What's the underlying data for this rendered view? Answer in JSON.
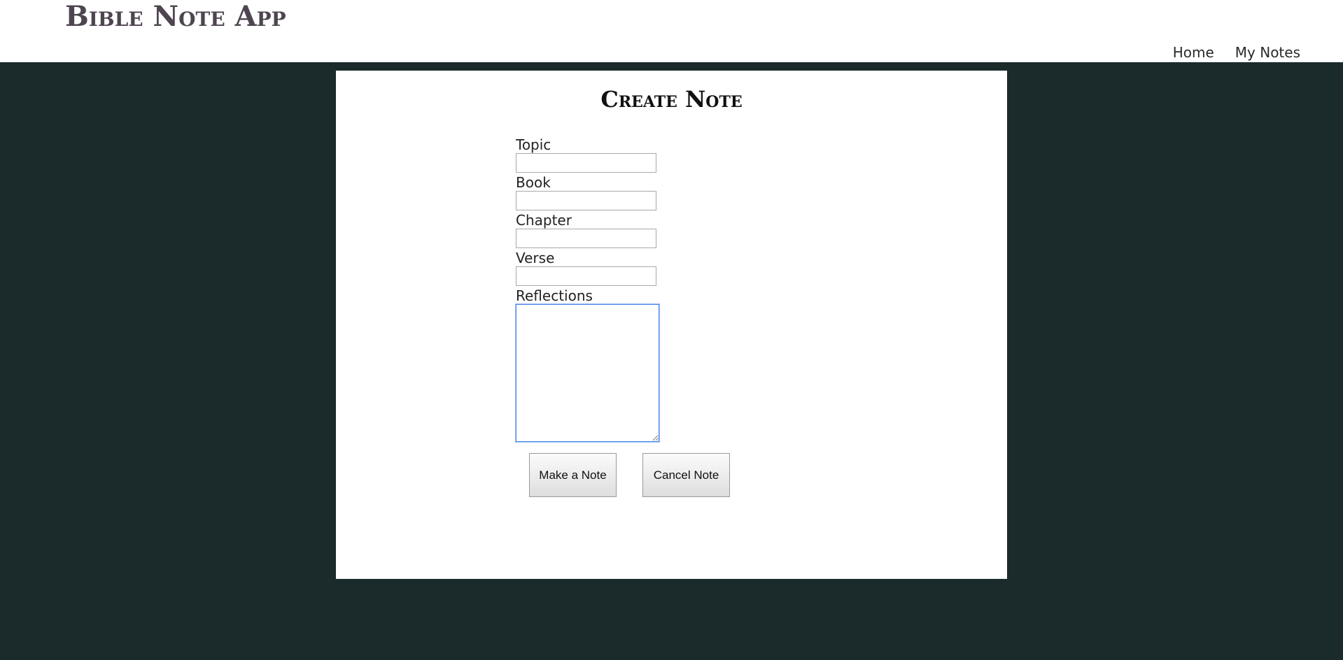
{
  "header": {
    "app_title": "Bible Note App",
    "nav": [
      {
        "label": "Home"
      },
      {
        "label": "My Notes"
      }
    ]
  },
  "panel": {
    "title": "Create Note"
  },
  "form": {
    "topic": {
      "label": "Topic",
      "value": ""
    },
    "book": {
      "label": "Book",
      "value": ""
    },
    "chapter": {
      "label": "Chapter",
      "value": ""
    },
    "verse": {
      "label": "Verse",
      "value": ""
    },
    "reflections": {
      "label": "Reflections",
      "value": ""
    }
  },
  "buttons": {
    "make_note": "Make a Note",
    "cancel_note": "Cancel Note"
  },
  "colors": {
    "background": "#1b2b2c",
    "header_bg": "#ffffff",
    "title_color": "#4e4550",
    "focus_border": "#4a86e8"
  }
}
